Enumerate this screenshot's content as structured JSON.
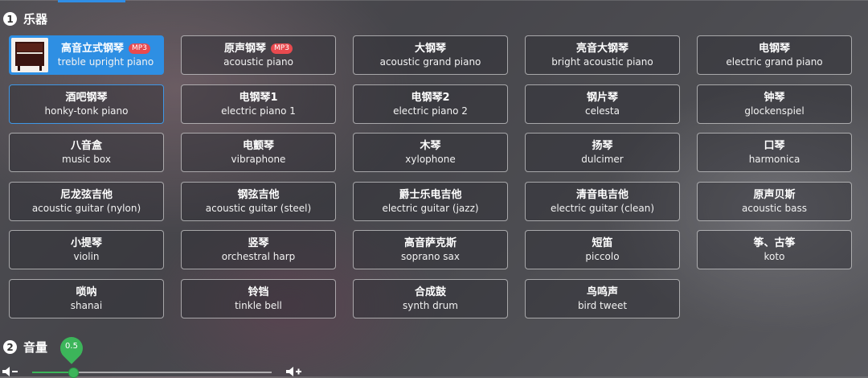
{
  "sections": {
    "instruments_number": "1",
    "instruments_title": "乐器",
    "volume_number": "2",
    "volume_title": "音量"
  },
  "instruments": [
    {
      "zh": "高音立式钢琴",
      "en": "treble upright piano",
      "badge": "MP3",
      "selected": true
    },
    {
      "zh": "原声钢琴",
      "en": "acoustic piano",
      "badge": "MP3"
    },
    {
      "zh": "大钢琴",
      "en": "acoustic grand piano"
    },
    {
      "zh": "亮音大钢琴",
      "en": "bright acoustic piano"
    },
    {
      "zh": "电钢琴",
      "en": "electric grand piano"
    },
    {
      "zh": "酒吧钢琴",
      "en": "honky-tonk piano",
      "hover": true
    },
    {
      "zh": "电钢琴1",
      "en": "electric piano 1"
    },
    {
      "zh": "电钢琴2",
      "en": "electric piano 2"
    },
    {
      "zh": "钢片琴",
      "en": "celesta"
    },
    {
      "zh": "钟琴",
      "en": "glockenspiel"
    },
    {
      "zh": "八音盒",
      "en": "music box"
    },
    {
      "zh": "电颤琴",
      "en": "vibraphone"
    },
    {
      "zh": "木琴",
      "en": "xylophone"
    },
    {
      "zh": "扬琴",
      "en": "dulcimer"
    },
    {
      "zh": "口琴",
      "en": "harmonica"
    },
    {
      "zh": "尼龙弦吉他",
      "en": "acoustic guitar (nylon)"
    },
    {
      "zh": "钢弦吉他",
      "en": "acoustic guitar (steel)"
    },
    {
      "zh": "爵士乐电吉他",
      "en": "electric guitar (jazz)"
    },
    {
      "zh": "清音电吉他",
      "en": "electric guitar (clean)"
    },
    {
      "zh": "原声贝斯",
      "en": "acoustic bass"
    },
    {
      "zh": "小提琴",
      "en": "violin"
    },
    {
      "zh": "竖琴",
      "en": "orchestral harp"
    },
    {
      "zh": "高音萨克斯",
      "en": "soprano sax"
    },
    {
      "zh": "短笛",
      "en": "piccolo"
    },
    {
      "zh": "筝、古筝",
      "en": "koto"
    },
    {
      "zh": "唢呐",
      "en": "shanai"
    },
    {
      "zh": "铃铛",
      "en": "tinkle bell"
    },
    {
      "zh": "合成鼓",
      "en": "synth drum"
    },
    {
      "zh": "鸟鸣声",
      "en": "bird tweet"
    }
  ],
  "volume": {
    "value_label": "0.5",
    "level": 0.17,
    "decrease_icon": "volume-down-icon",
    "increase_icon": "volume-up-icon"
  },
  "colors": {
    "accent": "#2e8fe3",
    "badge": "#e84a4f",
    "volume": "#3cb55a"
  }
}
